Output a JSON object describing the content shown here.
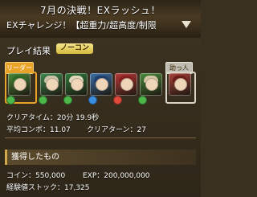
{
  "header": {
    "title": "7月の決戦！EXラッシュ！",
    "subtitle": "EXチャレンジ！【超重力/超高度/制限",
    "expand_icon": "triangle-down-icon"
  },
  "result": {
    "section_title": "プレイ結果",
    "badge": "ノーコン",
    "leader_label": "リーダー",
    "friend_label": "助っ人",
    "clear_time": "クリアタイム：20分 19.9秒",
    "avg_combo": "平均コンボ：11.07",
    "clear_turns": "クリアターン：27"
  },
  "team": [
    {
      "name": "leader-monster",
      "color": "#4d8a3a",
      "hair": "#2f6a25"
    },
    {
      "name": "monster-2",
      "color": "#3e8a4e",
      "hair": "#c9c2a8"
    },
    {
      "name": "monster-3",
      "color": "#2f7a3c",
      "hair": "#e0d8bc"
    },
    {
      "name": "monster-4",
      "color": "#3d6fa8",
      "hair": "#1e3e6e"
    },
    {
      "name": "monster-5",
      "color": "#b93a3a",
      "hair": "#8a1f1f"
    },
    {
      "name": "monster-6",
      "color": "#4b8c3d",
      "hair": "#d1c6a3"
    },
    {
      "name": "friend-monster",
      "color": "#a8423a",
      "hair": "#6e1c18"
    }
  ],
  "gained": {
    "section_title": "獲得したもの",
    "coin": "コイン：550,000",
    "exp": "EXP：200,000,000",
    "exp_stock": "経験値ストック：17,325"
  },
  "colors": {
    "accent": "#e8a227",
    "badge": "#f6e68d",
    "panel": "#3c3221"
  }
}
